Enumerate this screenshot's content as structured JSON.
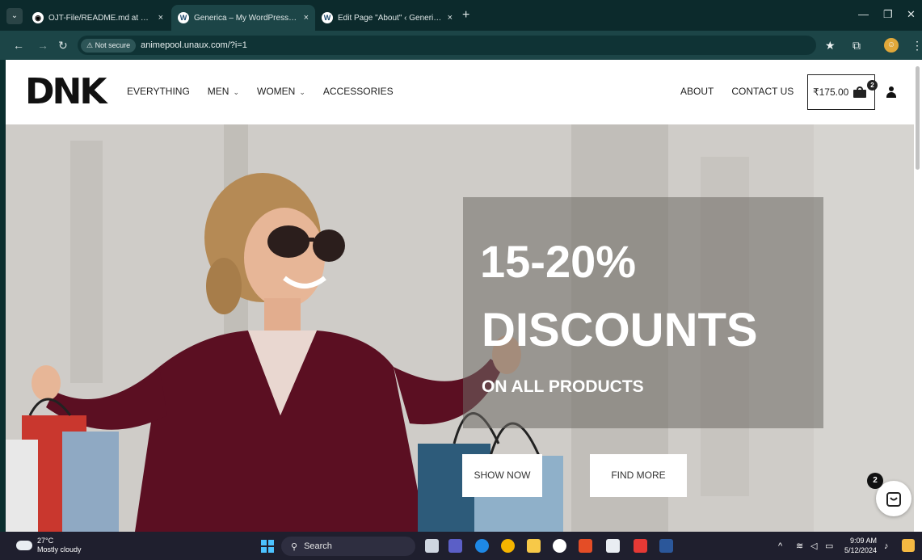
{
  "browser": {
    "tabs": [
      {
        "title": "OJT-File/README.md at main · ",
        "icon": "github-icon",
        "active": false
      },
      {
        "title": "Generica – My WordPress Blog",
        "icon": "wordpress-icon",
        "active": true
      },
      {
        "title": "Edit Page \"About\" ‹ Generica — ",
        "icon": "wordpress-icon",
        "active": false
      }
    ],
    "close_glyph": "×",
    "new_tab_glyph": "+",
    "security_label": "Not secure",
    "url": "animepool.unaux.com/?i=1"
  },
  "site": {
    "logo": "DNK",
    "nav_left": [
      {
        "label": "EVERYTHING",
        "dropdown": false
      },
      {
        "label": "MEN",
        "dropdown": true
      },
      {
        "label": "WOMEN",
        "dropdown": true
      },
      {
        "label": "ACCESSORIES",
        "dropdown": false
      }
    ],
    "nav_right": [
      {
        "label": "ABOUT"
      },
      {
        "label": "CONTACT US"
      }
    ],
    "cart": {
      "total": "₹175.00",
      "count": "2"
    }
  },
  "hero": {
    "line1": "15-20%",
    "line2": "DISCOUNTS",
    "line3": "ON ALL PRODUCTS",
    "buttons": [
      "SHOW NOW",
      "FIND MORE"
    ],
    "floating_cart_count": "2"
  },
  "taskbar": {
    "temperature": "27°C",
    "weather": "Mostly cloudy",
    "search_label": "Search",
    "time": "9:09 AM",
    "date": "5/12/2024"
  },
  "colors": {
    "tab_bar": "#0c2a2c",
    "toolbar": "#1c4547",
    "taskbar": "#1f1f2e",
    "promo_panel": "#6e6964"
  }
}
